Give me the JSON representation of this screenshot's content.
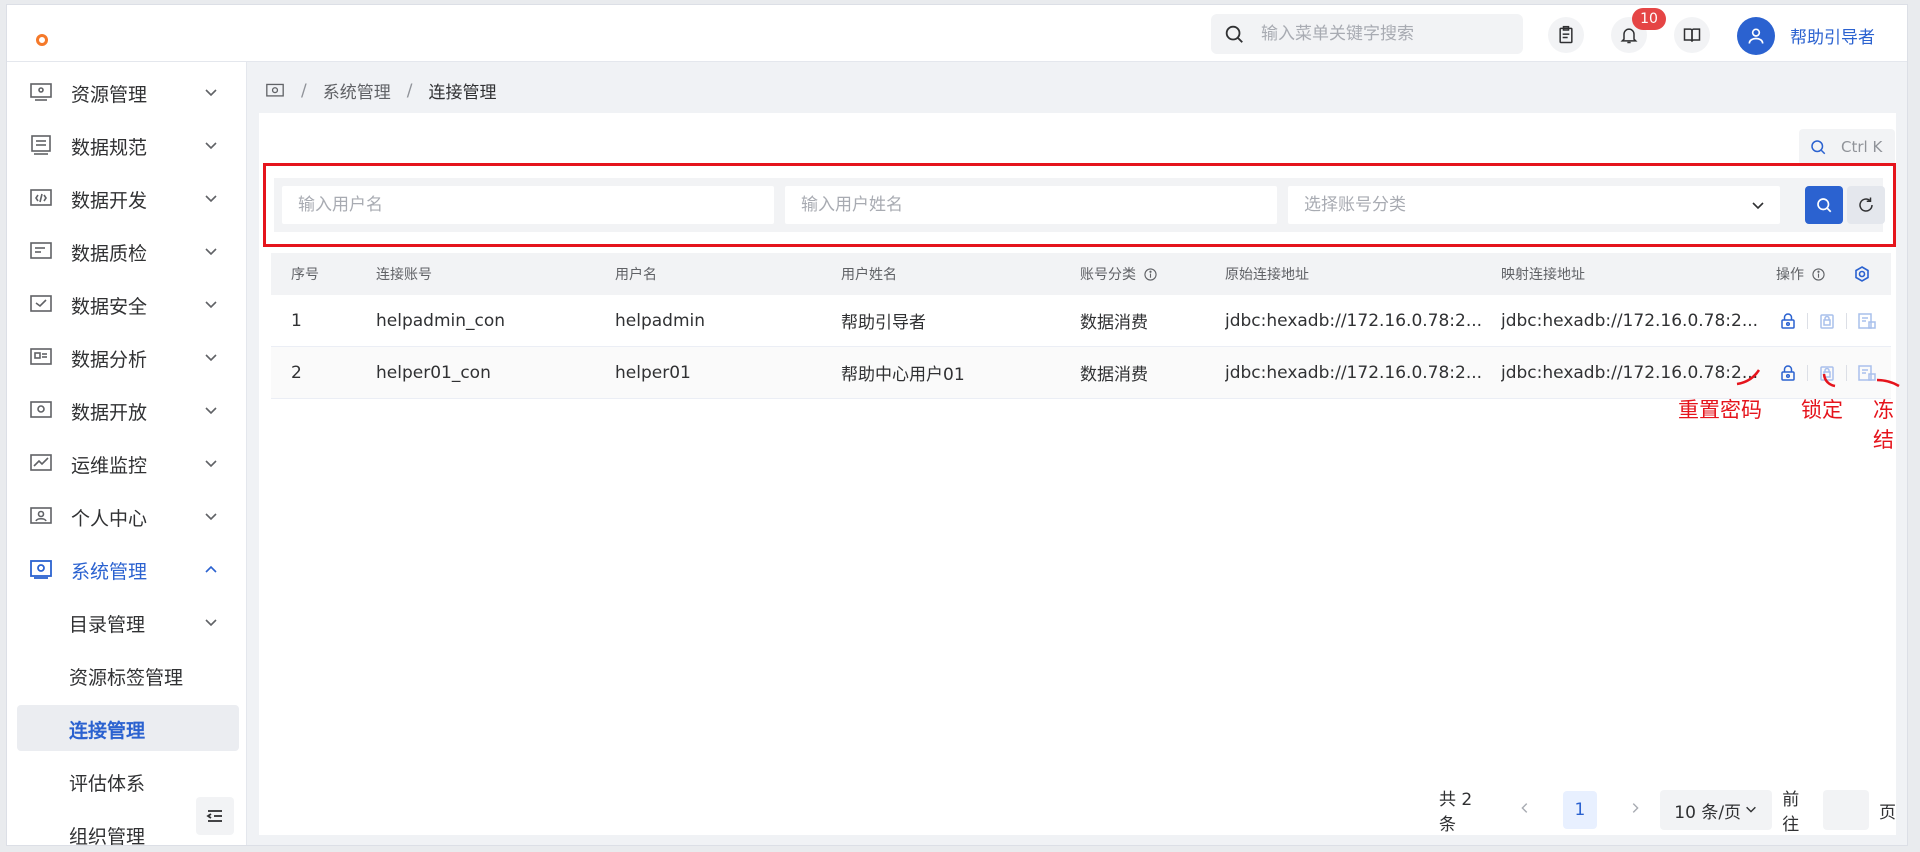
{
  "topbar": {
    "search_placeholder": "输入菜单关键字搜索",
    "notification_count": "10",
    "user_name": "帮助引导者"
  },
  "sidebar": {
    "items": [
      {
        "label": "资源管理",
        "icon": "resource-icon"
      },
      {
        "label": "数据规范",
        "icon": "standard-icon"
      },
      {
        "label": "数据开发",
        "icon": "code-icon"
      },
      {
        "label": "数据质检",
        "icon": "quality-icon"
      },
      {
        "label": "数据安全",
        "icon": "security-icon"
      },
      {
        "label": "数据分析",
        "icon": "analysis-icon"
      },
      {
        "label": "数据开放",
        "icon": "open-icon"
      },
      {
        "label": "运维监控",
        "icon": "monitor-icon"
      },
      {
        "label": "个人中心",
        "icon": "user-icon"
      },
      {
        "label": "系统管理",
        "icon": "system-icon"
      }
    ],
    "sub_items": [
      {
        "label": "目录管理"
      },
      {
        "label": "资源标签管理"
      },
      {
        "label": "连接管理"
      },
      {
        "label": "评估体系"
      },
      {
        "label": "组织管理"
      }
    ]
  },
  "breadcrumb": [
    "系统管理",
    "连接管理"
  ],
  "toolbar": {
    "shortcut": "Ctrl K"
  },
  "filters": {
    "username_placeholder": "输入用户名",
    "fullname_placeholder": "输入用户姓名",
    "category_placeholder": "选择账号分类"
  },
  "table": {
    "headers": [
      "序号",
      "连接账号",
      "用户名",
      "用户姓名",
      "账号分类",
      "原始连接地址",
      "映射连接地址",
      "操作"
    ],
    "rows": [
      [
        "1",
        "helpadmin_con",
        "helpadmin",
        "帮助引导者",
        "数据消费",
        "jdbc:hexadb://172.16.0.78:2...",
        "jdbc:hexadb://172.16.0.78:2..."
      ],
      [
        "2",
        "helper01_con",
        "helper01",
        "帮助中心用户01",
        "数据消费",
        "jdbc:hexadb://172.16.0.78:2...",
        "jdbc:hexadb://172.16.0.78:2..."
      ]
    ]
  },
  "annotations": {
    "reset_password": "重置密码",
    "lock": "锁定",
    "freeze": "冻结"
  },
  "pagination": {
    "total": "共 2 条",
    "current_page": "1",
    "page_size": "10 条/页",
    "goto_prefix": "前往",
    "goto_suffix": "页"
  },
  "colors": {
    "primary": "#2b62d0",
    "annotation": "#e5141c",
    "badge": "#e54545"
  }
}
